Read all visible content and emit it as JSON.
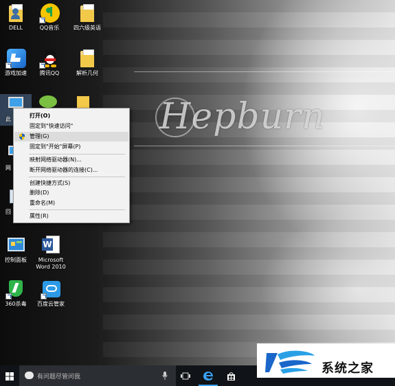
{
  "wallpaper": {
    "title": "Hepburn"
  },
  "desktop_icons": [
    {
      "key": "dell",
      "label": "DELL",
      "icon": "user-folder-icon"
    },
    {
      "key": "qqmusic",
      "label": "QQ音乐",
      "icon": "qq-music-icon"
    },
    {
      "key": "cet",
      "label": "四六级英语",
      "icon": "folder-icon"
    },
    {
      "key": "game",
      "label": "游戏加速",
      "icon": "game-accelerator-icon"
    },
    {
      "key": "qq",
      "label": "腾讯QQ",
      "icon": "qq-penguin-icon"
    },
    {
      "key": "geometry",
      "label": "解析几何",
      "icon": "folder-icon"
    },
    {
      "key": "thispc",
      "label": "此",
      "icon": "computer-icon"
    },
    {
      "key": "network",
      "label": "网",
      "icon": "network-icon"
    },
    {
      "key": "recycle",
      "label": "回",
      "icon": "recycle-bin-icon"
    },
    {
      "key": "control",
      "label": "控制面板",
      "icon": "control-panel-icon"
    },
    {
      "key": "word",
      "label": "Microsoft Word 2010",
      "icon": "word-icon"
    },
    {
      "key": "av360",
      "label": "360杀毒",
      "icon": "shield-360-icon"
    },
    {
      "key": "baiducloud",
      "label": "百度云管家",
      "icon": "baidu-cloud-icon"
    }
  ],
  "context_menu": {
    "items": [
      {
        "label": "打开(O)"
      },
      {
        "label": "固定到\"快速访问\""
      },
      {
        "label": "管理(G)"
      },
      {
        "label": "固定到\"开始\"屏幕(P)"
      },
      {
        "label": "映射网络驱动器(N)..."
      },
      {
        "label": "断开网络驱动器的连接(C)..."
      },
      {
        "label": "创建快捷方式(S)"
      },
      {
        "label": "删除(D)"
      },
      {
        "label": "重命名(M)"
      },
      {
        "label": "属性(R)"
      }
    ]
  },
  "taskbar": {
    "search_placeholder": "有问题尽管问我"
  },
  "watermark_logo": {
    "text": "系统之家"
  },
  "colors": {
    "accent": "#0078d7",
    "menu_bg": "#f2f2f2",
    "taskbar_bg": "#101418"
  }
}
